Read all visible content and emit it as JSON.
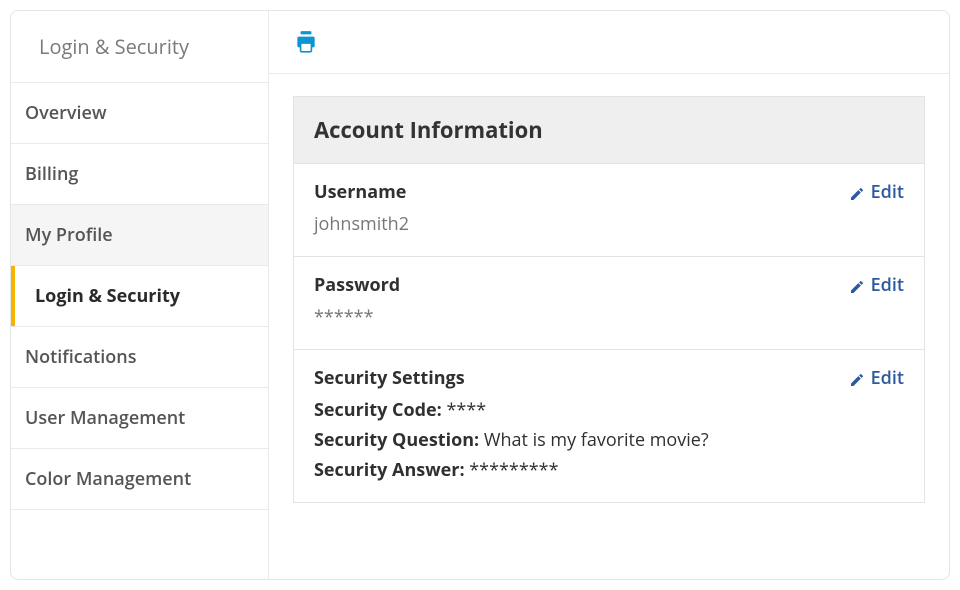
{
  "sidebar": {
    "header": "Login & Security",
    "items": [
      {
        "label": "Overview",
        "active": false,
        "group": false
      },
      {
        "label": "Billing",
        "active": false,
        "group": false
      },
      {
        "label": "My Profile",
        "active": false,
        "group": true
      },
      {
        "label": "Login & Security",
        "active": true,
        "group": false
      },
      {
        "label": "Notifications",
        "active": false,
        "group": false
      },
      {
        "label": "User Management",
        "active": false,
        "group": false
      },
      {
        "label": "Color Management",
        "active": false,
        "group": false
      }
    ]
  },
  "toolbar": {
    "print_icon": "print-icon"
  },
  "account": {
    "section_title": "Account Information",
    "edit_label": "Edit",
    "username_label": "Username",
    "username_value": "johnsmith2",
    "password_label": "Password",
    "password_value": "******",
    "security_label": "Security Settings",
    "security_code_label": "Security Code:",
    "security_code_value": "****",
    "security_question_label": "Security Question:",
    "security_question_value": "What is my favorite movie?",
    "security_answer_label": "Security Answer:",
    "security_answer_value": "*********"
  },
  "colors": {
    "accent_blue": "#0d94d2",
    "link_blue": "#2c5aa0",
    "active_border": "#f4b400"
  }
}
